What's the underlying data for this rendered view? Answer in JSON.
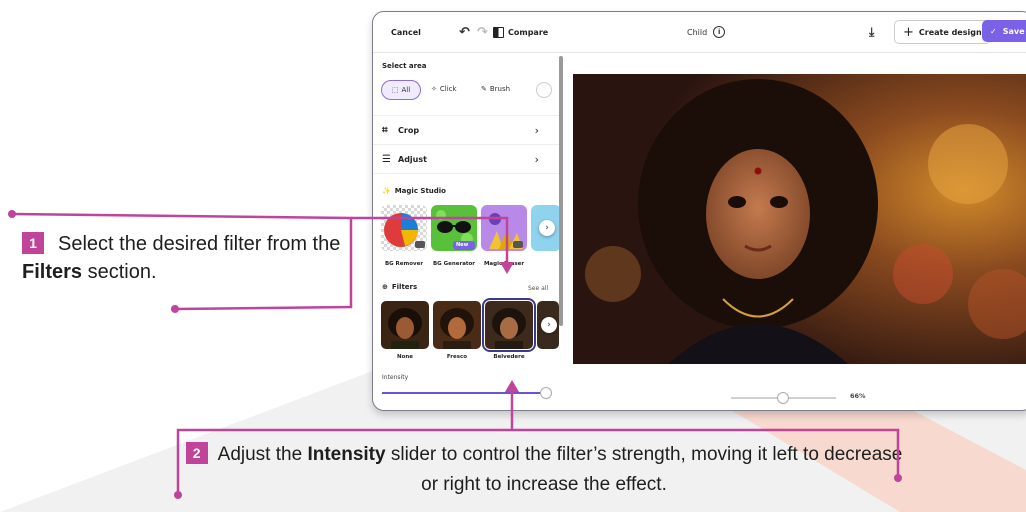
{
  "topbar": {
    "cancel_label": "Cancel",
    "undo_icon": "undo-icon",
    "redo_icon": "redo-icon",
    "compare_label": "Compare",
    "title": "Child",
    "info_icon": "info-icon",
    "download_icon": "download-icon",
    "create_design_label": "Create design",
    "save_label": "Save"
  },
  "sidebar": {
    "select_area_title": "Select area",
    "selection_modes": [
      {
        "label": "All",
        "icon": "select-all-icon",
        "selected": true
      },
      {
        "label": "Click",
        "icon": "magic-click-icon",
        "selected": false
      },
      {
        "label": "Brush",
        "icon": "brush-icon",
        "selected": false
      }
    ],
    "rows": [
      {
        "label": "Crop",
        "icon": "crop-icon"
      },
      {
        "label": "Adjust",
        "icon": "sliders-icon"
      }
    ],
    "magic_studio_title": "Magic Studio",
    "magic_tools": [
      {
        "label": "BG Remover",
        "badge": ""
      },
      {
        "label": "BG Generator",
        "badge": "New"
      },
      {
        "label": "Magic Eraser",
        "badge": ""
      }
    ],
    "filters_title": "Filters",
    "see_all_label": "See all",
    "filters": [
      {
        "label": "None",
        "selected": false
      },
      {
        "label": "Fresco",
        "selected": false
      },
      {
        "label": "Belvedere",
        "selected": true
      }
    ],
    "intensity_label": "Intensity",
    "intensity_value": 1.0
  },
  "canvas": {
    "zoom_label": "66%",
    "zoom_fraction": 0.45
  },
  "callouts": {
    "step1_number": "1",
    "step1_pre": "Select the desired filter from the ",
    "step1_bold": "Filters",
    "step1_post": " section.",
    "step2_number": "2",
    "step2_pre": "Adjust the ",
    "step2_bold": "Intensity",
    "step2_post": " slider to control the filter’s strength, moving it left to decrease or right to increase the effect."
  },
  "colors": {
    "accent_purple": "#7a62e8",
    "callout_magenta": "#c0449a",
    "watermark_orange": "#f4623a"
  }
}
